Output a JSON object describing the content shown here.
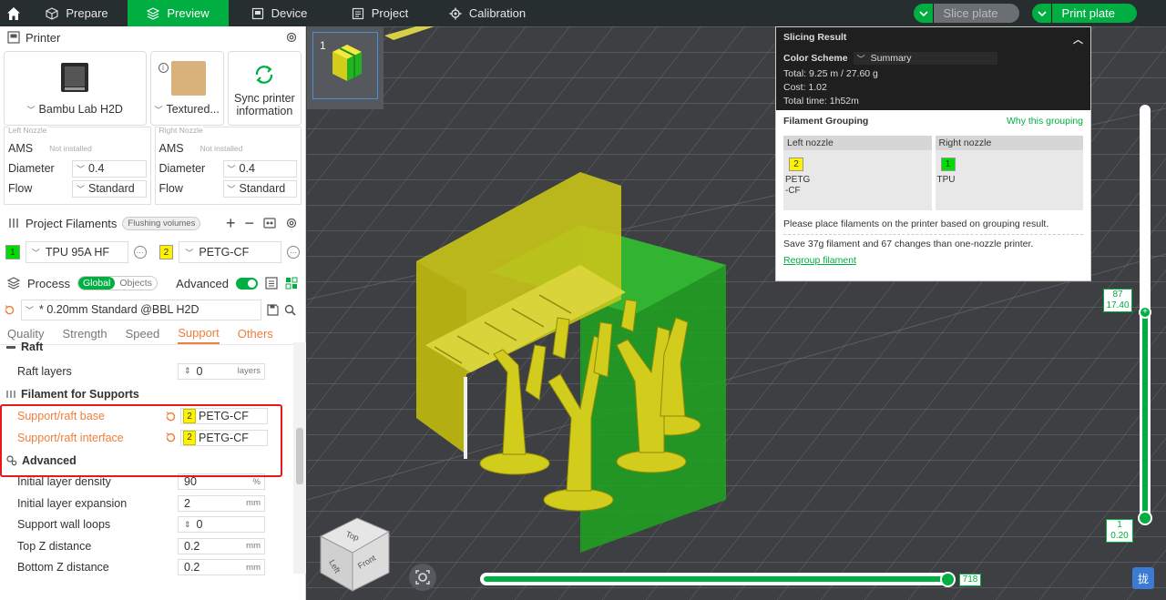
{
  "topbar": {
    "tabs": [
      {
        "label": "Prepare",
        "icon": "cube-icon"
      },
      {
        "label": "Preview",
        "icon": "layers-icon"
      },
      {
        "label": "Device",
        "icon": "device-icon"
      },
      {
        "label": "Project",
        "icon": "project-icon"
      },
      {
        "label": "Calibration",
        "icon": "calibration-icon"
      }
    ],
    "active_tab": "Preview",
    "slice_label": "Slice plate",
    "print_label": "Print plate"
  },
  "printer": {
    "section_title": "Printer",
    "printer_name": "Bambu Lab H2D",
    "plate_name": "Textured...",
    "sync_label": "Sync printer information",
    "left_nozzle": {
      "title": "Left Nozzle",
      "ams_label": "AMS",
      "ams_value": "Not installed",
      "diameter_label": "Diameter",
      "diameter": "0.4",
      "flow_label": "Flow",
      "flow": "Standard"
    },
    "right_nozzle": {
      "title": "Right Nozzle",
      "ams_label": "AMS",
      "ams_value": "Not installed",
      "diameter_label": "Diameter",
      "diameter": "0.4",
      "flow_label": "Flow",
      "flow": "Standard"
    }
  },
  "filaments": {
    "section_title": "Project Filaments",
    "flushing_label": "Flushing volumes",
    "items": [
      {
        "slot": "1",
        "name": "TPU 95A HF",
        "color": "#00dd00"
      },
      {
        "slot": "2",
        "name": "PETG-CF",
        "color": "#fff200"
      }
    ]
  },
  "process": {
    "section_title": "Process",
    "seg_global": "Global",
    "seg_objects": "Objects",
    "advanced_label": "Advanced",
    "preset": "* 0.20mm Standard @BBL H2D",
    "tabs": [
      "Quality",
      "Strength",
      "Speed",
      "Support",
      "Others"
    ],
    "active_tab": "Support",
    "raft_group": "Raft",
    "raft_layers_label": "Raft layers",
    "raft_layers_value": "0",
    "raft_layers_unit": "layers",
    "filament_group": "Filament for Supports",
    "support_base_label": "Support/raft base",
    "support_base_slot": "2",
    "support_base_value": "PETG-CF",
    "support_interface_label": "Support/raft interface",
    "support_interface_slot": "2",
    "support_interface_value": "PETG-CF",
    "advanced_group": "Advanced",
    "initial_density_label": "Initial layer density",
    "initial_density_value": "90",
    "initial_density_unit": "%",
    "initial_expansion_label": "Initial layer expansion",
    "initial_expansion_value": "2",
    "initial_expansion_unit": "mm",
    "wall_loops_label": "Support wall loops",
    "wall_loops_value": "0",
    "top_z_label": "Top Z distance",
    "top_z_value": "0.2",
    "top_z_unit": "mm",
    "bottom_z_label": "Bottom Z distance",
    "bottom_z_value": "0.2",
    "bottom_z_unit": "mm"
  },
  "viewport": {
    "plate_number": "1",
    "cube_top": "Top",
    "cube_left": "Left",
    "cube_front": "Front"
  },
  "result": {
    "title": "Slicing Result",
    "color_scheme_label": "Color Scheme",
    "color_scheme_value": "Summary",
    "total": "Total:  9.25 m / 27.60 g",
    "cost": "Cost:  1.02",
    "time": "Total time:  1h52m",
    "grouping_title": "Filament Grouping",
    "why_label": "Why this grouping",
    "left_nozzle_label": "Left nozzle",
    "left_slot": "2",
    "left_name_1": "PETG",
    "left_name_2": "-CF",
    "right_nozzle_label": "Right nozzle",
    "right_slot": "1",
    "right_name": "TPU",
    "note": "Please place filaments on the printer based on grouping result.",
    "save_note": "Save 37g filament and 67 changes than one-nozzle printer.",
    "regroup_label": "Regroup filament"
  },
  "layer_slider": {
    "top_layer": "87",
    "top_height": "17.40",
    "bottom_layer": "1",
    "bottom_height": "0.20",
    "top_fraction": 1.0,
    "bottom_fraction": 0.0
  },
  "move_slider": {
    "value": "718",
    "fraction": 1.0
  },
  "lang_badge": "拢"
}
